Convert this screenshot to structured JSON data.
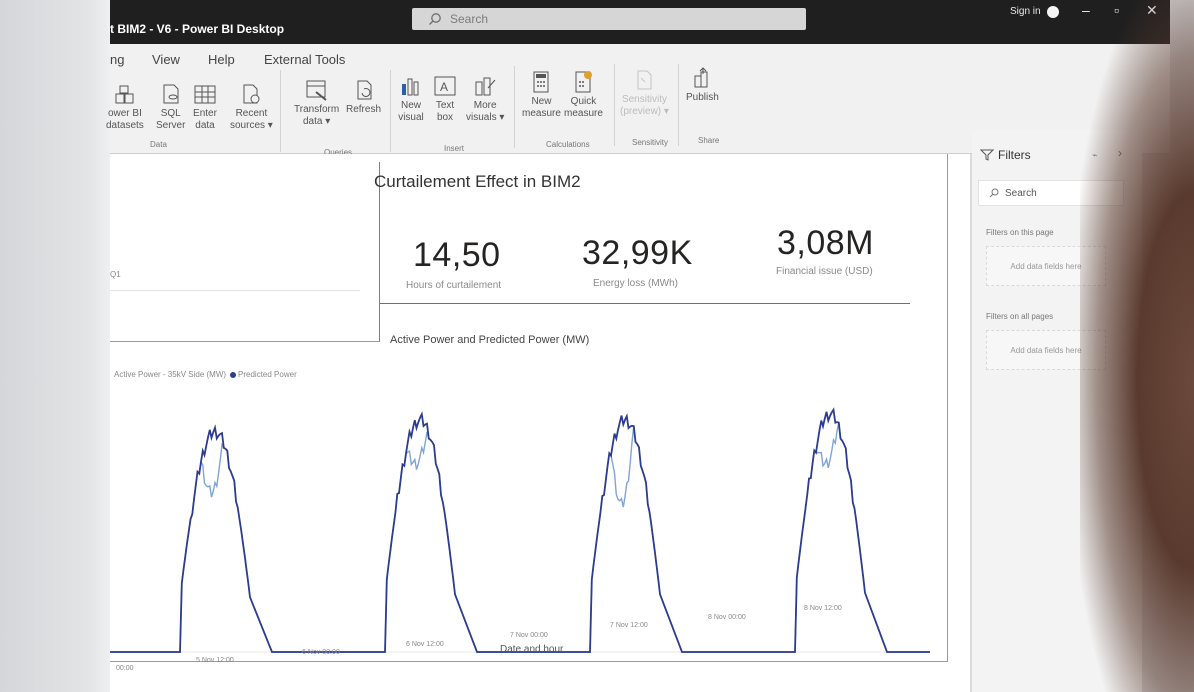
{
  "window": {
    "title": "t BIM2 - V6 - Power BI Desktop",
    "search_label": "Search",
    "sign_in": "Sign in",
    "controls": {
      "minimize": "–",
      "maximize": "▫",
      "close": "✕"
    }
  },
  "ribbon": {
    "tabs": [
      "ng",
      "View",
      "Help",
      "External Tools"
    ],
    "buttons": {
      "power_bi_datasets": "ower BI\ndatasets",
      "sql_server": "SQL\nServer",
      "enter_data": "Enter\ndata",
      "recent_sources": "Recent\nsources ▾",
      "transform_data": "Transform\ndata ▾",
      "refresh": "Refresh",
      "new_visual": "New\nvisual",
      "text_box": "Text\nbox",
      "more_visuals": "More\nvisuals ▾",
      "new_measure": "New\nmeasure",
      "quick_measure": "Quick\nmeasure",
      "sensitivity": "Sensitivity\n(preview) ▾",
      "publish": "Publish"
    },
    "groups": {
      "data": "Data",
      "queries": "Queries",
      "insert": "Insert",
      "calculations": "Calculations",
      "sensitivity": "Sensitivity",
      "share": "Share"
    }
  },
  "left_visual": {
    "label": "Q1"
  },
  "card": {
    "title": "Curtailement Effect in BIM2",
    "kpis": [
      {
        "value": "14,50",
        "label": "Hours of curtailement"
      },
      {
        "value": "32,99K",
        "label": "Energy loss (MWh)"
      },
      {
        "value": "3,08M",
        "label": "Financial issue (USD)"
      }
    ]
  },
  "chart_data": {
    "type": "line",
    "title": "Active Power and Predicted Power (MW)",
    "xlabel": "Date and hour",
    "ylabel": "",
    "x_ticks": [
      "00:00",
      "5 Nov 12:00",
      "6 Nov 00:00",
      "6 Nov 12:00",
      "7 Nov 00:00",
      "7 Nov 12:00",
      "8 Nov 00:00",
      "8 Nov 12:00"
    ],
    "series": [
      {
        "name": "Active Power - 35kV Side (MW)",
        "color": "#7fa4d6"
      },
      {
        "name": "Predicted Power",
        "color": "#2c3c8f"
      }
    ],
    "days": [
      {
        "peak": 37,
        "dip": 10
      },
      {
        "peak": 39,
        "dip": 7
      },
      {
        "peak": 39,
        "dip": 14
      },
      {
        "peak": 40,
        "dip": 8
      }
    ],
    "ylim": [
      0,
      42
    ],
    "grid": false,
    "legend_position": "top-left"
  },
  "filters": {
    "title": "Filters",
    "search": "Search",
    "on_this_page": "Filters on this page",
    "on_this_page_drop": "Add data fields here",
    "on_all_pages": "Filters on all pages",
    "on_all_pages_drop": "Add data fields here"
  },
  "colors": {
    "titlebar": "#1f1f1f",
    "ribbon": "#f1f1f1",
    "predicted": "#2c3c8f",
    "active": "#7fa4d6"
  }
}
